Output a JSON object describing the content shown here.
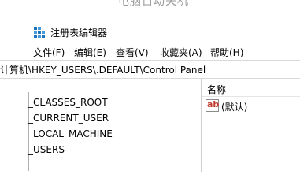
{
  "background_title": "电脑自动关机",
  "window": {
    "title": "注册表编辑器",
    "icon": "registry-editor-icon"
  },
  "menu": [
    {
      "label": "文件(F)"
    },
    {
      "label": "编辑(E)"
    },
    {
      "label": "查看(V)"
    },
    {
      "label": "收藏夹(A)"
    },
    {
      "label": "帮助(H)"
    }
  ],
  "address": {
    "path": "计算机\\HKEY_USERS\\.DEFAULT\\Control Panel"
  },
  "tree": {
    "items": [
      {
        "label": "_CLASSES_ROOT"
      },
      {
        "label": "_CURRENT_USER"
      },
      {
        "label": "_LOCAL_MACHINE"
      },
      {
        "label": "_USERS"
      }
    ]
  },
  "values_pane": {
    "column_name": "名称",
    "rows": [
      {
        "icon": "string-value-icon",
        "icon_text": "ab",
        "name": "(默认)"
      }
    ]
  },
  "colors": {
    "ab_icon": "#c0392b",
    "divider": "#cfcfcf"
  }
}
